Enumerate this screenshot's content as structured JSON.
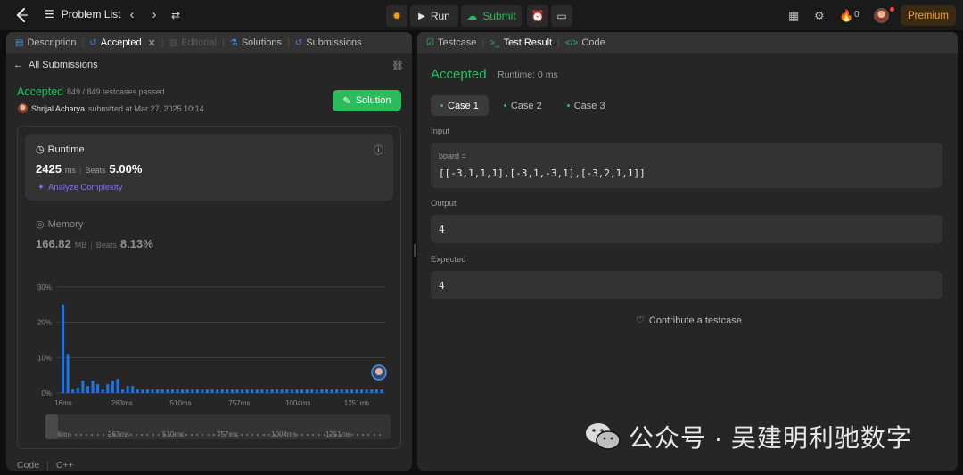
{
  "topbar": {
    "problem_list": "Problem List",
    "run_label": "Run",
    "submit_label": "Submit",
    "streak_count": "0",
    "premium_label": "Premium"
  },
  "left": {
    "tabs": [
      {
        "label": "Description",
        "icon": "document-icon",
        "state": "normal"
      },
      {
        "label": "Accepted",
        "icon": "history-icon",
        "state": "active"
      },
      {
        "label": "Editorial",
        "icon": "book-icon",
        "state": "disabled"
      },
      {
        "label": "Solutions",
        "icon": "flask-icon",
        "state": "normal"
      },
      {
        "label": "Submissions",
        "icon": "history-icon",
        "state": "normal"
      }
    ],
    "back_label": "All Submissions",
    "status": "Accepted",
    "passed": "849 / 849 testcases passed",
    "author": "Shrijal Acharya",
    "submitted_text": "submitted at Mar 27, 2025 10:14",
    "solution_button": "Solution",
    "runtime": {
      "title": "Runtime",
      "value": "2425",
      "unit": "ms",
      "beats_label": "Beats",
      "beats_value": "5.00%",
      "analyze": "Analyze Complexity"
    },
    "memory": {
      "title": "Memory",
      "value": "166.82",
      "unit": "MB",
      "beats_label": "Beats",
      "beats_value": "8.13%"
    },
    "code_label": "Code",
    "lang_label": "C++"
  },
  "chart_data": {
    "type": "bar",
    "title": "",
    "xlabel": "",
    "ylabel": "",
    "ylim": [
      0,
      30
    ],
    "yticks": [
      "0%",
      "10%",
      "20%",
      "30%"
    ],
    "xticks": [
      "16ms",
      "263ms",
      "510ms",
      "757ms",
      "1004ms",
      "1251ms"
    ],
    "grid": true,
    "values": [
      25,
      11,
      1,
      1.5,
      3.5,
      2,
      3.5,
      2.5,
      1,
      2.5,
      3.5,
      4,
      1,
      2,
      2,
      1,
      1,
      1,
      1,
      1,
      1,
      1,
      1,
      1,
      1,
      1,
      1,
      1,
      1,
      1,
      1,
      1,
      1,
      1,
      1,
      1,
      1,
      1,
      1,
      1,
      1,
      1,
      1,
      1,
      1,
      1,
      1,
      1,
      1,
      1,
      1,
      1,
      1,
      1,
      1,
      1,
      1,
      1,
      1,
      1,
      1,
      1,
      1,
      1,
      1
    ],
    "highlight_color": "#1a73e8",
    "user_marker": "avatar"
  },
  "right": {
    "tabs": [
      {
        "label": "Testcase",
        "icon": "checkbox-icon",
        "state": "normal"
      },
      {
        "label": "Test Result",
        "icon": "terminal-icon",
        "state": "active"
      },
      {
        "label": "Code",
        "icon": "code-icon",
        "state": "normal"
      }
    ],
    "status": "Accepted",
    "runtime": "Runtime: 0 ms",
    "cases": [
      "Case 1",
      "Case 2",
      "Case 3"
    ],
    "input_label": "Input",
    "input_key": "board =",
    "input_value": "[[-3,1,1,1],[-3,1,-3,1],[-3,2,1,1]]",
    "output_label": "Output",
    "output_value": "4",
    "expected_label": "Expected",
    "expected_value": "4",
    "contribute": "Contribute a testcase"
  },
  "watermark": "公众号 · 吴建明利驰数字",
  "colors": {
    "accent_green": "#2cbb5d",
    "premium_orange": "#ffa116",
    "bar_blue": "#1a73e8",
    "analyze_purple": "#8c6cf0"
  }
}
